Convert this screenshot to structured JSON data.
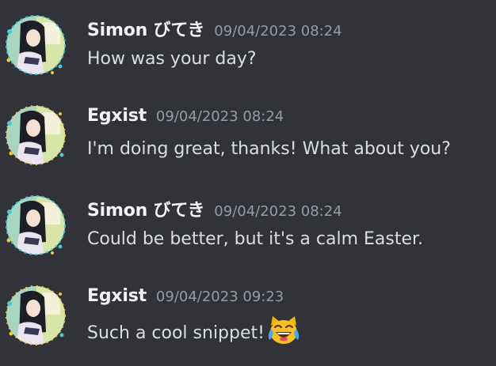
{
  "messages": [
    {
      "username": "Simon びてき",
      "timestamp": "09/04/2023 08:24",
      "text": "How was your day?"
    },
    {
      "username": "Egxist",
      "timestamp": "09/04/2023 08:24",
      "text": "I'm doing great, thanks! What about you?"
    },
    {
      "username": "Simon びてき",
      "timestamp": "09/04/2023 08:24",
      "text": "Could be better, but it's a calm Easter."
    },
    {
      "username": "Egxist",
      "timestamp": "09/04/2023 09:23",
      "text": "Such a cool snippet!",
      "emoji": "laughing-tears-cat-emoji"
    }
  ],
  "colors": {
    "background": "#313338",
    "username": "#f2f3f5",
    "timestamp": "#949ba4",
    "message_text": "#dbdee1"
  }
}
